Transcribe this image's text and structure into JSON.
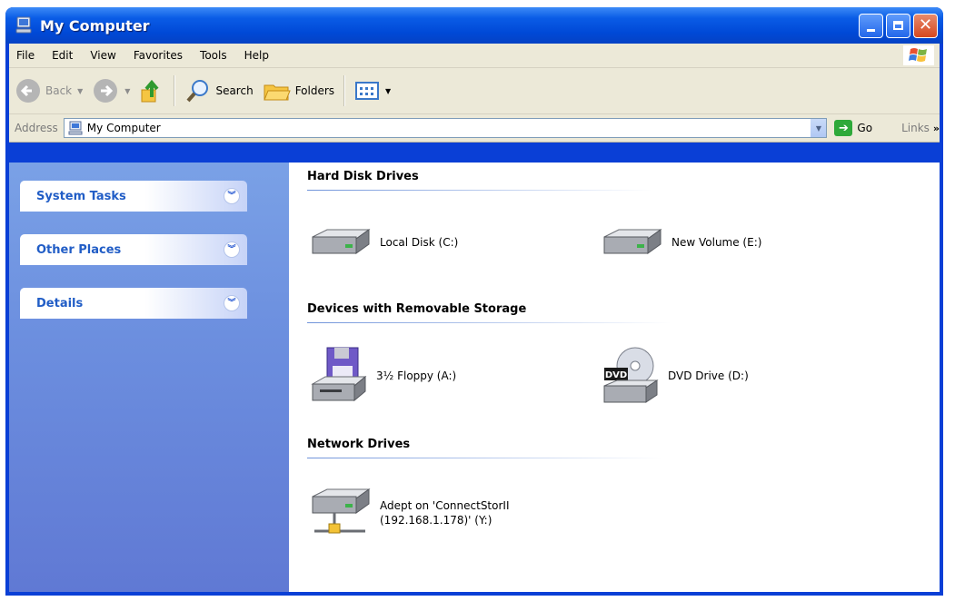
{
  "window": {
    "title": "My Computer",
    "title_bg": "#0a5ce6"
  },
  "menu": [
    "File",
    "Edit",
    "View",
    "Favorites",
    "Tools",
    "Help"
  ],
  "toolbar": {
    "back_label": "Back",
    "search_label": "Search",
    "folders_label": "Folders"
  },
  "address": {
    "label": "Address",
    "value": "My Computer",
    "go_label": "Go",
    "links_label": "Links"
  },
  "tasks": [
    {
      "title": "System Tasks"
    },
    {
      "title": "Other Places"
    },
    {
      "title": "Details"
    }
  ],
  "sections": {
    "hard_disks": {
      "title": "Hard Disk Drives",
      "items": [
        {
          "label": "Local Disk (C:)",
          "icon": "hard-drive-icon"
        },
        {
          "label": "New Volume (E:)",
          "icon": "hard-drive-icon"
        }
      ]
    },
    "removable": {
      "title": "Devices with Removable Storage",
      "items": [
        {
          "label": "3½ Floppy (A:)",
          "icon": "floppy-drive-icon"
        },
        {
          "label": "DVD Drive (D:)",
          "icon": "dvd-drive-icon"
        }
      ]
    },
    "network": {
      "title": "Network Drives",
      "items": [
        {
          "label_line1": "Adept on 'ConnectStorII",
          "label_line2": "(192.168.1.178)' (Y:)",
          "icon": "network-drive-icon"
        }
      ]
    }
  },
  "colors": {
    "window_frame": "#0a3fd6",
    "taskpane": "#6c8fdf",
    "task_title": "#215dc6"
  }
}
